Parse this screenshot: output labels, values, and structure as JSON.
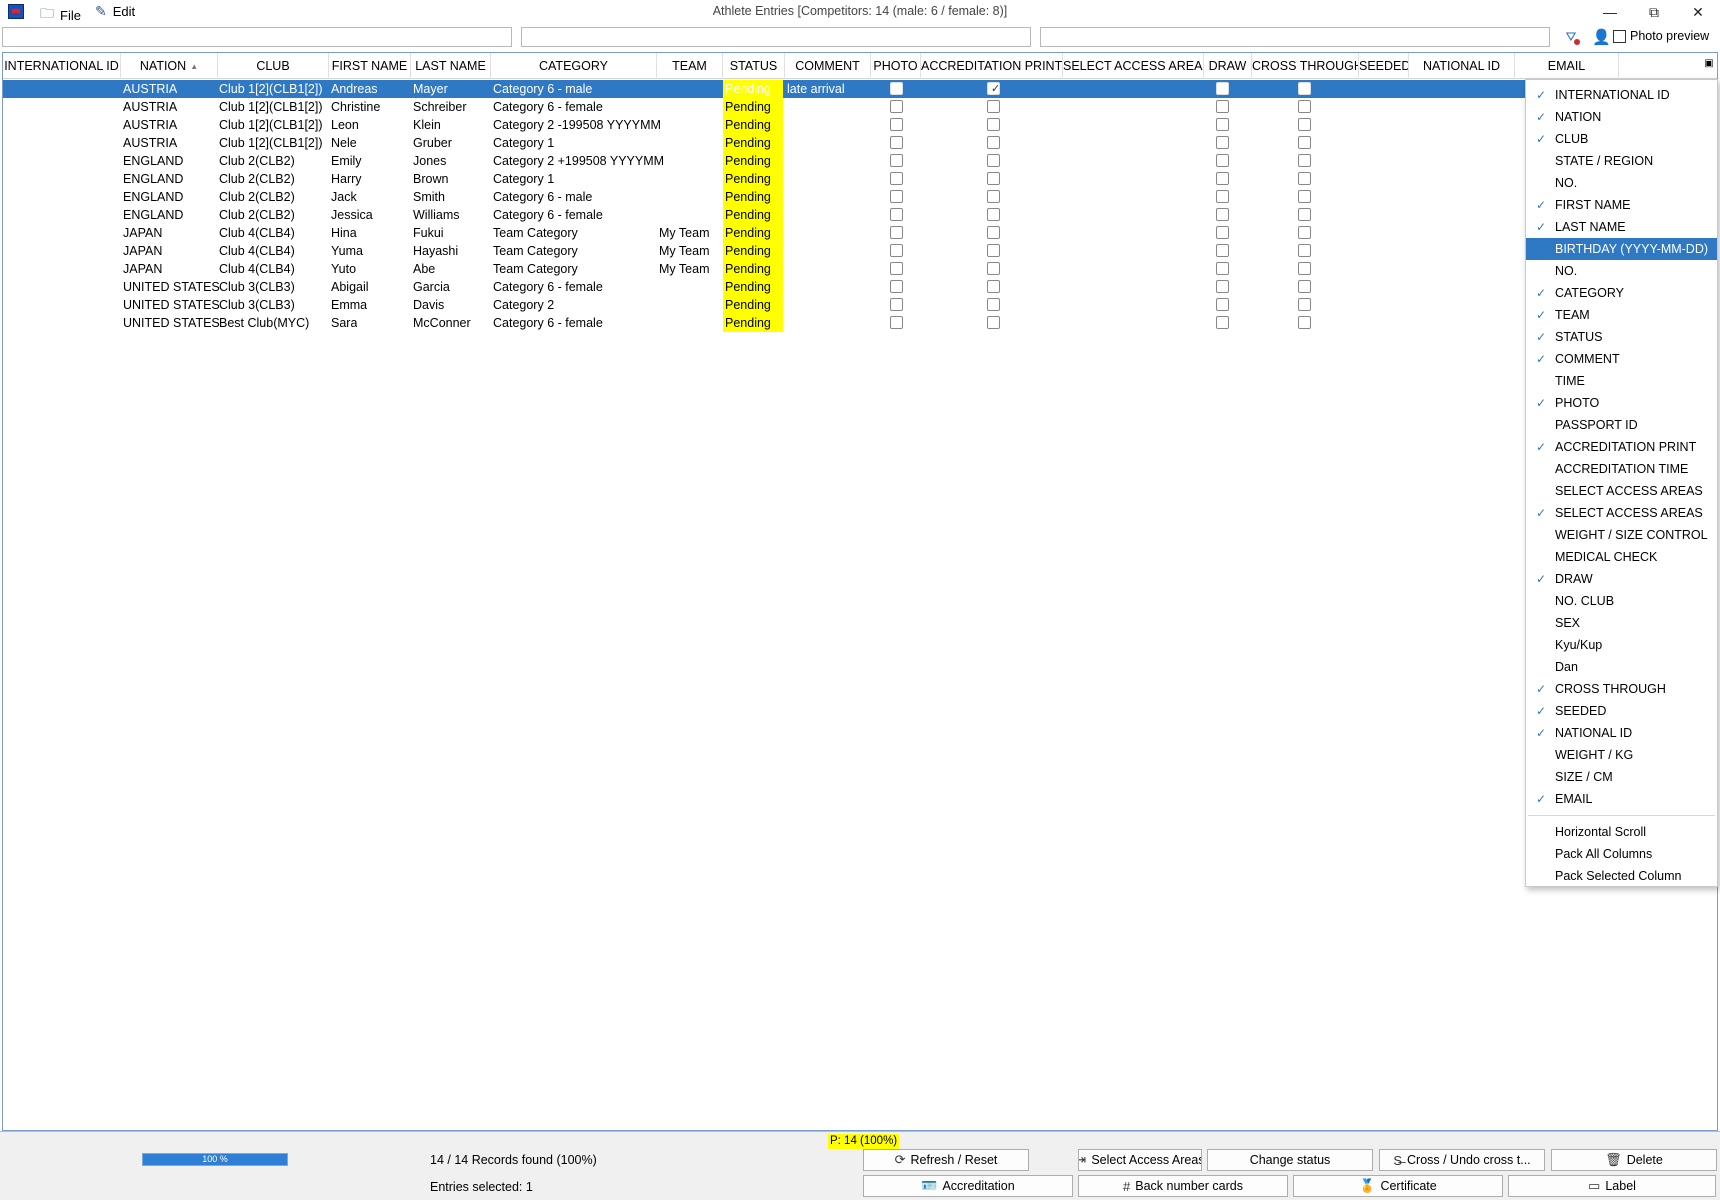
{
  "window": {
    "title": "Athlete Entries [Competitors: 14 (male: 6 / female: 8)]",
    "menu": [
      {
        "label": "File",
        "icon": "folder-icon"
      },
      {
        "label": "Edit",
        "icon": "edit-icon"
      }
    ],
    "controls": {
      "minimize": "—",
      "restore": "⧉",
      "close": "✕"
    }
  },
  "toolbar": {
    "filters": [
      "",
      "",
      ""
    ],
    "photo_preview_label": "Photo preview",
    "photo_preview_checked": false
  },
  "table": {
    "columns": [
      {
        "key": "intl_id",
        "label": "INTERNATIONAL ID"
      },
      {
        "key": "nation",
        "label": "NATION",
        "sorted": "asc"
      },
      {
        "key": "club",
        "label": "CLUB"
      },
      {
        "key": "first",
        "label": "FIRST NAME"
      },
      {
        "key": "last",
        "label": "LAST NAME"
      },
      {
        "key": "category",
        "label": "CATEGORY"
      },
      {
        "key": "team",
        "label": "TEAM"
      },
      {
        "key": "status",
        "label": "STATUS"
      },
      {
        "key": "comment",
        "label": "COMMENT"
      },
      {
        "key": "photo",
        "label": "PHOTO"
      },
      {
        "key": "accr",
        "label": "ACCREDITATION PRINT"
      },
      {
        "key": "areas",
        "label": "SELECT ACCESS AREAS"
      },
      {
        "key": "draw",
        "label": "DRAW"
      },
      {
        "key": "cross",
        "label": "CROSS THROUGH"
      },
      {
        "key": "seeded",
        "label": "SEEDED"
      },
      {
        "key": "natid",
        "label": "NATIONAL ID"
      },
      {
        "key": "email",
        "label": "EMAIL"
      }
    ],
    "rows": [
      {
        "nation": "AUSTRIA",
        "club": "Club 1[2](CLB1[2])",
        "first": "Andreas",
        "last": "Mayer",
        "category": "Category 6 - male",
        "team": "",
        "status": "Pending",
        "comment": "late arrival",
        "photo": false,
        "accr": true,
        "draw": false,
        "cross": false,
        "selected": true
      },
      {
        "nation": "AUSTRIA",
        "club": "Club 1[2](CLB1[2])",
        "first": "Christine",
        "last": "Schreiber",
        "category": "Category 6 - female",
        "team": "",
        "status": "Pending",
        "comment": "",
        "photo": false,
        "accr": false,
        "draw": false,
        "cross": false
      },
      {
        "nation": "AUSTRIA",
        "club": "Club 1[2](CLB1[2])",
        "first": "Leon",
        "last": "Klein",
        "category": "Category 2 -199508 YYYYMM",
        "team": "",
        "status": "Pending",
        "comment": "",
        "photo": false,
        "accr": false,
        "draw": false,
        "cross": false
      },
      {
        "nation": "AUSTRIA",
        "club": "Club 1[2](CLB1[2])",
        "first": "Nele",
        "last": "Gruber",
        "category": "Category 1",
        "team": "",
        "status": "Pending",
        "comment": "",
        "photo": false,
        "accr": false,
        "draw": false,
        "cross": false
      },
      {
        "nation": "ENGLAND",
        "club": "Club 2(CLB2)",
        "first": "Emily",
        "last": "Jones",
        "category": "Category 2 +199508 YYYYMM",
        "team": "",
        "status": "Pending",
        "comment": "",
        "photo": false,
        "accr": false,
        "draw": false,
        "cross": false
      },
      {
        "nation": "ENGLAND",
        "club": "Club 2(CLB2)",
        "first": "Harry",
        "last": "Brown",
        "category": "Category 1",
        "team": "",
        "status": "Pending",
        "comment": "",
        "photo": false,
        "accr": false,
        "draw": false,
        "cross": false
      },
      {
        "nation": "ENGLAND",
        "club": "Club 2(CLB2)",
        "first": "Jack",
        "last": "Smith",
        "category": "Category 6 - male",
        "team": "",
        "status": "Pending",
        "comment": "",
        "photo": false,
        "accr": false,
        "draw": false,
        "cross": false
      },
      {
        "nation": "ENGLAND",
        "club": "Club 2(CLB2)",
        "first": "Jessica",
        "last": "Williams",
        "category": "Category 6 - female",
        "team": "",
        "status": "Pending",
        "comment": "",
        "photo": false,
        "accr": false,
        "draw": false,
        "cross": false
      },
      {
        "nation": "JAPAN",
        "club": "Club 4(CLB4)",
        "first": "Hina",
        "last": "Fukui",
        "category": "Team Category",
        "team": "My Team",
        "status": "Pending",
        "comment": "",
        "photo": false,
        "accr": false,
        "draw": false,
        "cross": false
      },
      {
        "nation": "JAPAN",
        "club": "Club 4(CLB4)",
        "first": "Yuma",
        "last": "Hayashi",
        "category": "Team Category",
        "team": "My Team",
        "status": "Pending",
        "comment": "",
        "photo": false,
        "accr": false,
        "draw": false,
        "cross": false
      },
      {
        "nation": "JAPAN",
        "club": "Club 4(CLB4)",
        "first": "Yuto",
        "last": "Abe",
        "category": "Team Category",
        "team": "My Team",
        "status": "Pending",
        "comment": "",
        "photo": false,
        "accr": false,
        "draw": false,
        "cross": false
      },
      {
        "nation": "UNITED STATES",
        "club": "Club 3(CLB3)",
        "first": "Abigail",
        "last": "Garcia",
        "category": "Category 6 - female",
        "team": "",
        "status": "Pending",
        "comment": "",
        "photo": false,
        "accr": false,
        "draw": false,
        "cross": false
      },
      {
        "nation": "UNITED STATES",
        "club": "Club 3(CLB3)",
        "first": "Emma",
        "last": "Davis",
        "category": "Category 2",
        "team": "",
        "status": "Pending",
        "comment": "",
        "photo": false,
        "accr": false,
        "draw": false,
        "cross": false
      },
      {
        "nation": "UNITED STATES",
        "club": "Best Club(MYC)",
        "first": "Sara",
        "last": "McConner",
        "category": "Category 6 - female",
        "team": "",
        "status": "Pending",
        "comment": "",
        "photo": false,
        "accr": false,
        "draw": false,
        "cross": false
      }
    ]
  },
  "column_menu": {
    "items": [
      {
        "label": "INTERNATIONAL ID",
        "checked": true
      },
      {
        "label": "NATION",
        "checked": true
      },
      {
        "label": "CLUB",
        "checked": true
      },
      {
        "label": "STATE / REGION",
        "checked": false
      },
      {
        "label": "NO.",
        "checked": false
      },
      {
        "label": "FIRST NAME",
        "checked": true
      },
      {
        "label": "LAST NAME",
        "checked": true
      },
      {
        "label": "BIRTHDAY (YYYY-MM-DD)",
        "checked": false,
        "highlighted": true
      },
      {
        "label": "NO.",
        "checked": false
      },
      {
        "label": "CATEGORY",
        "checked": true
      },
      {
        "label": "TEAM",
        "checked": true
      },
      {
        "label": "STATUS",
        "checked": true
      },
      {
        "label": "COMMENT",
        "checked": true
      },
      {
        "label": "TIME",
        "checked": false
      },
      {
        "label": "PHOTO",
        "checked": true
      },
      {
        "label": "PASSPORT ID",
        "checked": false
      },
      {
        "label": "ACCREDITATION PRINT",
        "checked": true
      },
      {
        "label": "ACCREDITATION TIME",
        "checked": false
      },
      {
        "label": "SELECT ACCESS AREAS",
        "checked": false
      },
      {
        "label": "SELECT ACCESS AREAS",
        "checked": true
      },
      {
        "label": "WEIGHT / SIZE CONTROL",
        "checked": false
      },
      {
        "label": "MEDICAL CHECK",
        "checked": false
      },
      {
        "label": "DRAW",
        "checked": true
      },
      {
        "label": "NO. CLUB",
        "checked": false
      },
      {
        "label": "SEX",
        "checked": false
      },
      {
        "label": "Kyu/Kup",
        "checked": false
      },
      {
        "label": "Dan",
        "checked": false
      },
      {
        "label": "CROSS THROUGH",
        "checked": true
      },
      {
        "label": "SEEDED",
        "checked": true
      },
      {
        "label": "NATIONAL ID",
        "checked": true
      },
      {
        "label": "WEIGHT / KG",
        "checked": false
      },
      {
        "label": "SIZE / CM",
        "checked": false
      },
      {
        "label": "EMAIL",
        "checked": true
      }
    ],
    "actions": [
      "Horizontal Scroll",
      "Pack All Columns",
      "Pack Selected Column"
    ]
  },
  "footer": {
    "p_label": "P: 14 (100%)",
    "progress_label": "100 %",
    "progress_value": 100,
    "records": "14 / 14 Records found (100%)",
    "entries_selected": "Entries selected: 1",
    "buttons_row1": [
      {
        "label": "Refresh / Reset",
        "icon": "refresh-icon"
      },
      {
        "label": "Select Access Areas",
        "icon": "access-areas-icon"
      },
      {
        "label": "Change status",
        "icon": ""
      },
      {
        "label": "Cross / Undo cross t...",
        "icon": "strikethrough-icon"
      },
      {
        "label": "Delete",
        "icon": "trash-icon"
      }
    ],
    "buttons_row2": [
      {
        "label": "Accreditation",
        "icon": "id-card-icon"
      },
      {
        "label": "Back number cards",
        "icon": "number-card-icon"
      },
      {
        "label": "Certificate",
        "icon": "medal-icon"
      },
      {
        "label": "Label",
        "icon": "label-icon"
      }
    ]
  }
}
